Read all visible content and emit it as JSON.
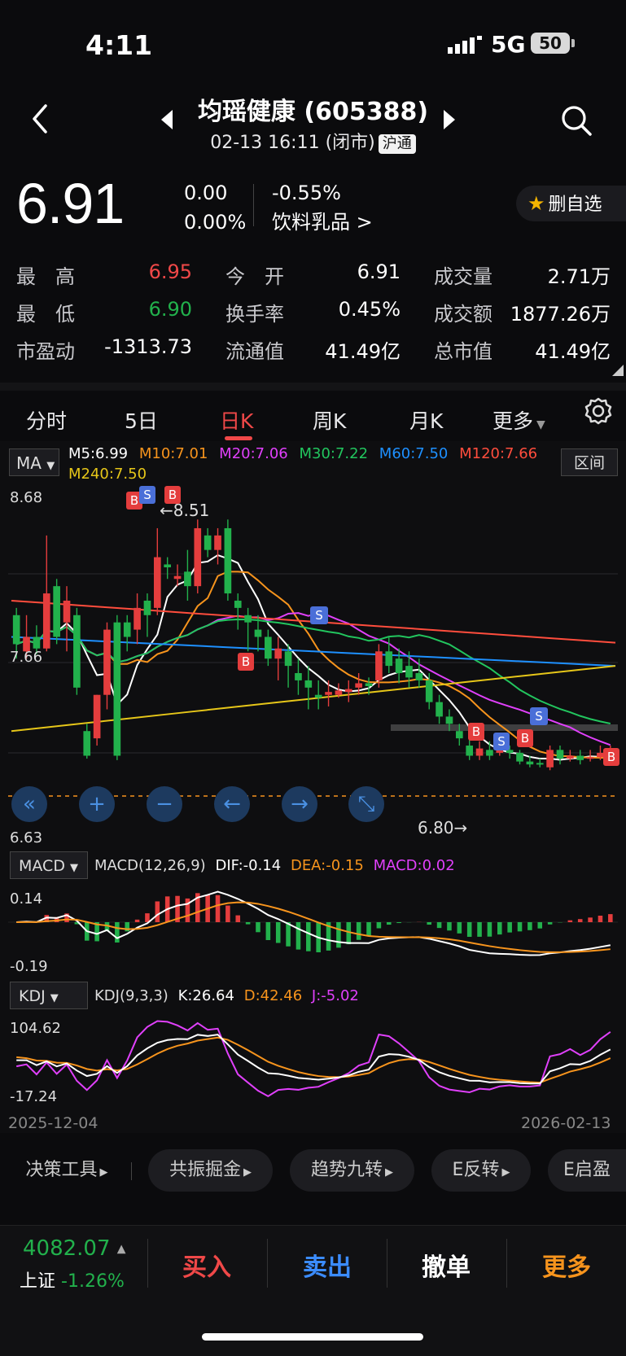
{
  "status": {
    "time": "4:11",
    "network": "5G",
    "battery": "50"
  },
  "header": {
    "title": "均瑶健康 (605388)",
    "subtitle": "02-13 16:11 (闭市)",
    "tag": "沪通"
  },
  "quote": {
    "price": "6.91",
    "change": "0.00",
    "change_pct": "0.00%",
    "sector_pct": "-0.55%",
    "sector": "饮料乳品 >",
    "fav_label": "删自选"
  },
  "stats": [
    {
      "label": "最　高",
      "value": "6.95"
    },
    {
      "label": "今　开",
      "value": "6.91"
    },
    {
      "label": "成交量",
      "value": "2.71万"
    },
    {
      "label": "最　低",
      "value": "6.90"
    },
    {
      "label": "换手率",
      "value": "0.45%"
    },
    {
      "label": "成交额",
      "value": "1877.26万"
    },
    {
      "label": "市盈动",
      "value": "-1313.73"
    },
    {
      "label": "流通值",
      "value": "41.49亿"
    },
    {
      "label": "总市值",
      "value": "41.49亿"
    }
  ],
  "tabs": [
    "分时",
    "5日",
    "日K",
    "周K",
    "月K",
    "更多"
  ],
  "active_tab": "日K",
  "ma": {
    "button": "MA",
    "range_button": "区间",
    "items": [
      {
        "text": "M5:6.99",
        "color": "#ffffff"
      },
      {
        "text": "M10:7.01",
        "color": "#f7941d"
      },
      {
        "text": "M20:7.06",
        "color": "#e040fb"
      },
      {
        "text": "M30:7.22",
        "color": "#22c55e"
      },
      {
        "text": "M60:7.50",
        "color": "#1e90ff"
      },
      {
        "text": "M120:7.66",
        "color": "#ff4d3d"
      },
      {
        "text": "M240:7.50",
        "color": "#e6c619"
      }
    ]
  },
  "kline_labels": {
    "high": "8.68",
    "low": "6.63",
    "mid": "7.66",
    "max_mark": "←8.51",
    "min_mark": "6.80→"
  },
  "controls": [
    "«",
    "+",
    "−",
    "←",
    "→",
    "⤡"
  ],
  "macd": {
    "button": "MACD",
    "params": "MACD(12,26,9)",
    "dif": "DIF:-0.14",
    "dea": "DEA:-0.15",
    "macd": "MACD:0.02",
    "top": "0.14",
    "bottom": "-0.19"
  },
  "kdj": {
    "button": "KDJ",
    "params": "KDJ(9,3,3)",
    "k": "K:26.64",
    "d": "D:42.46",
    "j": "J:-5.02",
    "top": "104.62",
    "bottom": "-17.24"
  },
  "dates": {
    "start": "2025-12-04",
    "end": "2026-02-13"
  },
  "tools": [
    "决策工具",
    "共振掘金",
    "趋势九转",
    "E反转",
    "E启盈"
  ],
  "index": {
    "value": "4082.07",
    "name": "上证",
    "pct": "-1.26%"
  },
  "actions": [
    {
      "label": "买入",
      "color": "#f04848"
    },
    {
      "label": "卖出",
      "color": "#3b8cff"
    },
    {
      "label": "撤单",
      "color": "#ffffff"
    },
    {
      "label": "更多",
      "color": "#f7941d"
    }
  ],
  "chart_data": {
    "type": "candlestick",
    "x_range": [
      "2025-12-04",
      "2026-02-13"
    ],
    "ylim": [
      6.63,
      8.68
    ],
    "candles": [
      [
        7.85,
        7.65,
        7.9,
        7.55
      ],
      [
        7.6,
        7.7,
        7.85,
        7.55
      ],
      [
        7.7,
        7.62,
        7.78,
        7.58
      ],
      [
        7.62,
        8.0,
        8.4,
        7.6
      ],
      [
        8.05,
        7.7,
        8.1,
        7.65
      ],
      [
        7.8,
        7.95,
        8.05,
        7.6
      ],
      [
        7.85,
        7.35,
        7.9,
        7.3
      ],
      [
        7.05,
        6.88,
        7.1,
        6.86
      ],
      [
        7.0,
        7.3,
        7.3,
        6.95
      ],
      [
        7.3,
        7.75,
        7.8,
        7.2
      ],
      [
        7.8,
        6.88,
        7.85,
        6.85
      ],
      [
        7.8,
        7.7,
        7.85,
        7.6
      ],
      [
        7.75,
        7.9,
        8.0,
        7.65
      ],
      [
        7.95,
        7.85,
        8.0,
        7.7
      ],
      [
        7.9,
        8.25,
        8.45,
        7.85
      ],
      [
        8.2,
        8.18,
        8.25,
        8.1
      ],
      [
        8.1,
        8.12,
        8.2,
        8.05
      ],
      [
        8.15,
        8.05,
        8.3,
        7.95
      ],
      [
        8.05,
        8.45,
        8.51,
        8.0
      ],
      [
        8.4,
        8.3,
        8.45,
        8.25
      ],
      [
        8.3,
        8.4,
        8.45,
        8.2
      ],
      [
        8.45,
        8.0,
        8.51,
        7.95
      ],
      [
        7.95,
        7.9,
        8.0,
        7.75
      ],
      [
        7.85,
        7.8,
        7.9,
        7.6
      ],
      [
        7.75,
        7.7,
        7.85,
        7.6
      ],
      [
        7.7,
        7.55,
        7.75,
        7.5
      ],
      [
        7.55,
        7.62,
        7.7,
        7.4
      ],
      [
        7.6,
        7.5,
        7.65,
        7.35
      ],
      [
        7.45,
        7.4,
        7.55,
        7.3
      ],
      [
        7.4,
        7.35,
        7.5,
        7.2
      ],
      [
        7.3,
        7.28,
        7.4,
        7.2
      ],
      [
        7.3,
        7.32,
        7.4,
        7.22
      ],
      [
        7.3,
        7.33,
        7.38,
        7.28
      ],
      [
        7.32,
        7.34,
        7.4,
        7.25
      ],
      [
        7.35,
        7.38,
        7.45,
        7.3
      ],
      [
        7.38,
        7.36,
        7.42,
        7.3
      ],
      [
        7.4,
        7.6,
        7.65,
        7.35
      ],
      [
        7.6,
        7.5,
        7.7,
        7.45
      ],
      [
        7.55,
        7.45,
        7.62,
        7.38
      ],
      [
        7.5,
        7.42,
        7.6,
        7.35
      ],
      [
        7.45,
        7.4,
        7.55,
        7.35
      ],
      [
        7.4,
        7.25,
        7.45,
        7.2
      ],
      [
        7.25,
        7.15,
        7.3,
        7.1
      ],
      [
        7.15,
        7.1,
        7.2,
        7.05
      ],
      [
        7.05,
        7.0,
        7.1,
        6.95
      ],
      [
        6.95,
        6.88,
        7.0,
        6.85
      ],
      [
        6.88,
        6.93,
        6.98,
        6.85
      ],
      [
        6.92,
        6.88,
        6.98,
        6.85
      ],
      [
        6.9,
        6.92,
        6.98,
        6.88
      ],
      [
        6.92,
        6.9,
        6.95,
        6.86
      ],
      [
        6.9,
        6.84,
        6.92,
        6.82
      ],
      [
        6.84,
        6.82,
        6.88,
        6.8
      ],
      [
        6.83,
        6.82,
        6.86,
        6.8
      ],
      [
        6.8,
        6.92,
        6.95,
        6.78
      ],
      [
        6.92,
        6.86,
        6.95,
        6.82
      ],
      [
        6.86,
        6.88,
        6.92,
        6.84
      ],
      [
        6.88,
        6.85,
        6.92,
        6.82
      ],
      [
        6.86,
        6.87,
        6.92,
        6.84
      ],
      [
        6.87,
        6.9,
        6.95,
        6.85
      ],
      [
        6.9,
        6.91,
        6.95,
        6.9
      ]
    ]
  }
}
